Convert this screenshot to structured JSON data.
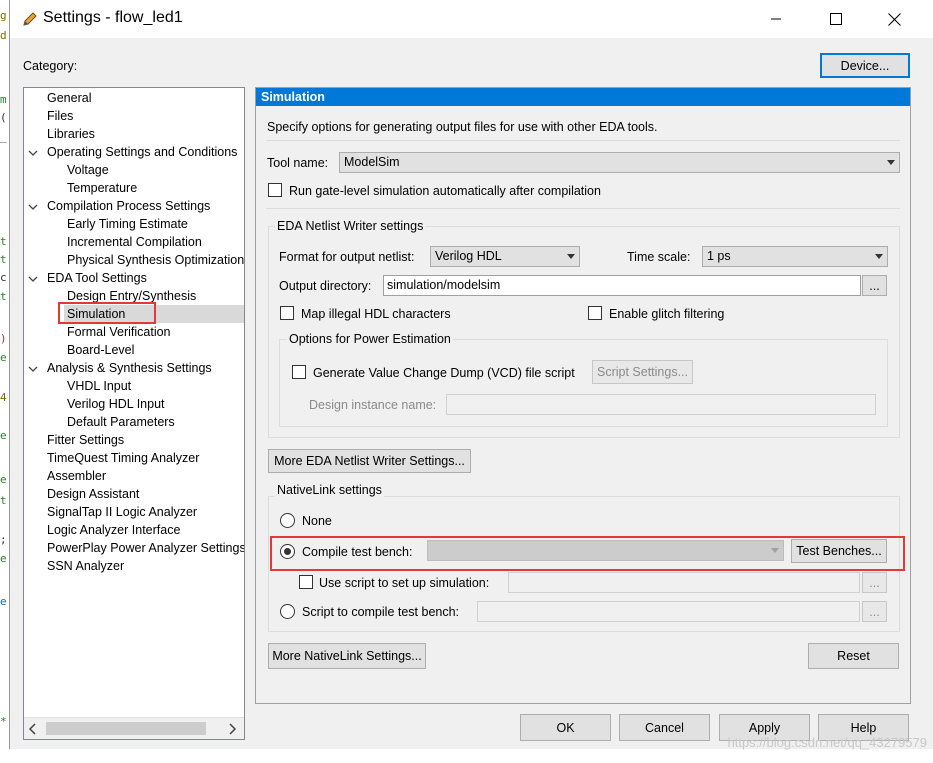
{
  "window": {
    "title": "Settings - flow_led1"
  },
  "category_label": "Category:",
  "device_button": "Device...",
  "tree": [
    {
      "label": "General",
      "level": 0
    },
    {
      "label": "Files",
      "level": 0
    },
    {
      "label": "Libraries",
      "level": 0
    },
    {
      "label": "Operating Settings and Conditions",
      "level": 0,
      "expanded": true
    },
    {
      "label": "Voltage",
      "level": 1
    },
    {
      "label": "Temperature",
      "level": 1
    },
    {
      "label": "Compilation Process Settings",
      "level": 0,
      "expanded": true
    },
    {
      "label": "Early Timing Estimate",
      "level": 1
    },
    {
      "label": "Incremental Compilation",
      "level": 1
    },
    {
      "label": "Physical Synthesis Optimization",
      "level": 1
    },
    {
      "label": "EDA Tool Settings",
      "level": 0,
      "expanded": true
    },
    {
      "label": "Design Entry/Synthesis",
      "level": 1
    },
    {
      "label": "Simulation",
      "level": 1,
      "selected": true
    },
    {
      "label": "Formal Verification",
      "level": 1
    },
    {
      "label": "Board-Level",
      "level": 1
    },
    {
      "label": "Analysis & Synthesis Settings",
      "level": 0,
      "expanded": true
    },
    {
      "label": "VHDL Input",
      "level": 1
    },
    {
      "label": "Verilog HDL Input",
      "level": 1
    },
    {
      "label": "Default Parameters",
      "level": 1
    },
    {
      "label": "Fitter Settings",
      "level": 0
    },
    {
      "label": "TimeQuest Timing Analyzer",
      "level": 0
    },
    {
      "label": "Assembler",
      "level": 0
    },
    {
      "label": "Design Assistant",
      "level": 0
    },
    {
      "label": "SignalTap II Logic Analyzer",
      "level": 0
    },
    {
      "label": "Logic Analyzer Interface",
      "level": 0
    },
    {
      "label": "PowerPlay Power Analyzer Settings",
      "level": 0
    },
    {
      "label": "SSN Analyzer",
      "level": 0
    }
  ],
  "panel": {
    "heading": "Simulation",
    "description": "Specify options for generating output files for use with other EDA tools.",
    "tool_name_label": "Tool name:",
    "tool_name_value": "ModelSim",
    "run_gate_level": "Run gate-level simulation automatically after compilation",
    "eda_group": {
      "title": "EDA Netlist Writer settings",
      "format_label": "Format for output netlist:",
      "format_value": "Verilog HDL",
      "timescale_label": "Time scale:",
      "timescale_value": "1 ps",
      "output_dir_label": "Output directory:",
      "output_dir_value": "simulation/modelsim",
      "browse": "...",
      "map_illegal": "Map illegal HDL characters",
      "enable_glitch": "Enable glitch filtering",
      "power_group": {
        "title": "Options for Power Estimation",
        "vcd_label": "Generate Value Change Dump (VCD) file script",
        "script_settings": "Script Settings...",
        "design_instance_label": "Design instance name:"
      }
    },
    "more_eda_button": "More EDA Netlist Writer Settings...",
    "nativelink": {
      "title": "NativeLink settings",
      "none": "None",
      "compile_tb": "Compile test bench:",
      "test_benches_button": "Test Benches...",
      "use_script": "Use script to set up simulation:",
      "script_compile": "Script to compile test bench:",
      "browse": "..."
    },
    "more_nativelink_button": "More NativeLink Settings...",
    "reset_button": "Reset"
  },
  "footer": {
    "ok": "OK",
    "cancel": "Cancel",
    "apply": "Apply",
    "help": "Help"
  },
  "watermark": "https://blog.csdn.net/qq_43279579"
}
